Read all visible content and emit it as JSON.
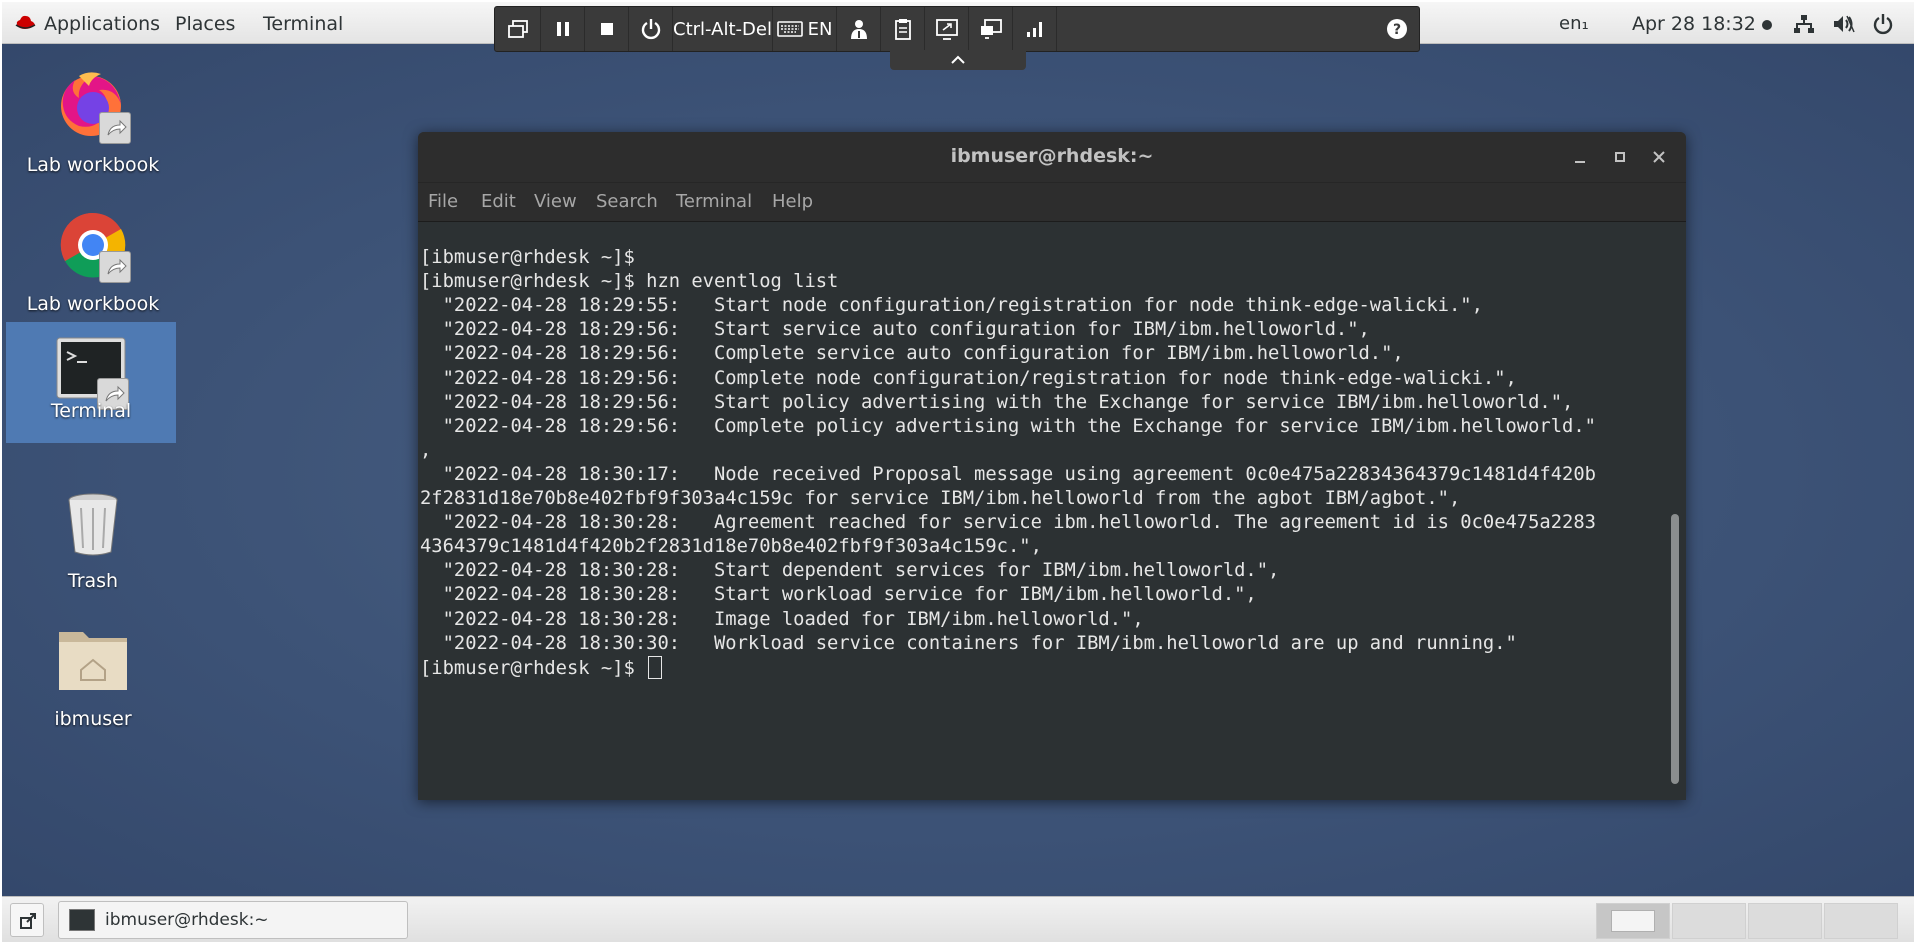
{
  "top_panel": {
    "applications": "Applications",
    "places": "Places",
    "terminal": "Terminal",
    "keyboard_indicator": "en₁",
    "clock": "Apr 28  18:32"
  },
  "vm_toolbar": {
    "ctrl_alt_del": "Ctrl-Alt-Del",
    "keyboard_lang": "EN"
  },
  "desktop_icons": [
    {
      "label": "Lab workbook",
      "icon": "firefox-icon"
    },
    {
      "label": "Lab workbook",
      "icon": "chrome-icon"
    },
    {
      "label": "Terminal",
      "icon": "terminal-icon"
    },
    {
      "label": "Trash",
      "icon": "trash-icon"
    },
    {
      "label": "ibmuser",
      "icon": "home-folder-icon"
    }
  ],
  "terminal": {
    "title": "ibmuser@rhdesk:~",
    "menu": [
      "File",
      "Edit",
      "View",
      "Search",
      "Terminal",
      "Help"
    ],
    "lines": [
      "[ibmuser@rhdesk ~]$",
      "[ibmuser@rhdesk ~]$ hzn eventlog list",
      "  \"2022-04-28 18:29:55:   Start node configuration/registration for node think-edge-walicki.\",",
      "  \"2022-04-28 18:29:56:   Start service auto configuration for IBM/ibm.helloworld.\",",
      "  \"2022-04-28 18:29:56:   Complete service auto configuration for IBM/ibm.helloworld.\",",
      "  \"2022-04-28 18:29:56:   Complete node configuration/registration for node think-edge-walicki.\",",
      "  \"2022-04-28 18:29:56:   Start policy advertising with the Exchange for service IBM/ibm.helloworld.\",",
      "  \"2022-04-28 18:29:56:   Complete policy advertising with the Exchange for service IBM/ibm.helloworld.\"",
      ",",
      "  \"2022-04-28 18:30:17:   Node received Proposal message using agreement 0c0e475a22834364379c1481d4f420b",
      "2f2831d18e70b8e402fbf9f303a4c159c for service IBM/ibm.helloworld from the agbot IBM/agbot.\",",
      "  \"2022-04-28 18:30:28:   Agreement reached for service ibm.helloworld. The agreement id is 0c0e475a2283",
      "4364379c1481d4f420b2f2831d18e70b8e402fbf9f303a4c159c.\",",
      "  \"2022-04-28 18:30:28:   Start dependent services for IBM/ibm.helloworld.\",",
      "  \"2022-04-28 18:30:28:   Start workload service for IBM/ibm.helloworld.\",",
      "  \"2022-04-28 18:30:28:   Image loaded for IBM/ibm.helloworld.\",",
      "  \"2022-04-28 18:30:30:   Workload service containers for IBM/ibm.helloworld are up and running.\""
    ],
    "prompt": "[ibmuser@rhdesk ~]$ "
  },
  "taskbar": {
    "window_label": "ibmuser@rhdesk:~"
  }
}
